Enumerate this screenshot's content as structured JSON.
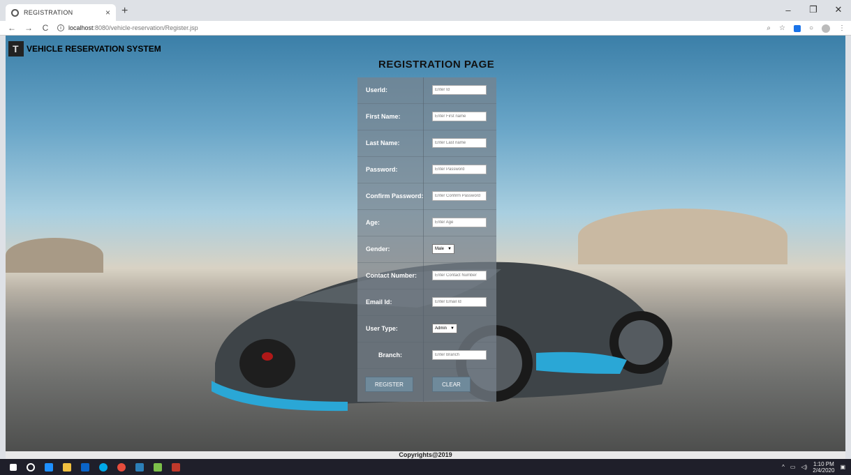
{
  "browser": {
    "tab_title": "REGISTRATION",
    "new_tab": "+",
    "url_host": "localhost",
    "url_path": ":8080/vehicle-reservation/Register.jsp",
    "window_controls": [
      "–",
      "❐",
      "✕"
    ]
  },
  "page": {
    "brand": "VEHICLE RESERVATION SYSTEM",
    "title": "REGISTRATION PAGE",
    "footer": "Copyrights@2019"
  },
  "form": {
    "fields": [
      {
        "label": "UserId:",
        "placeholder": "Enter Id"
      },
      {
        "label": "First Name:",
        "placeholder": "Enter First name"
      },
      {
        "label": "Last Name:",
        "placeholder": "Enter Last name"
      },
      {
        "label": "Password:",
        "placeholder": "Enter Password"
      },
      {
        "label": "Confirm Password:",
        "placeholder": "Enter Confirm Password"
      },
      {
        "label": "Age:",
        "placeholder": "Enter Age"
      },
      {
        "label": "Gender:",
        "value": "Male"
      },
      {
        "label": "Contact Number:",
        "placeholder": "Enter Contact Number"
      },
      {
        "label": "Email Id:",
        "placeholder": "Enter Email Id"
      },
      {
        "label": "User Type:",
        "value": "Admin"
      },
      {
        "label": "Branch:",
        "placeholder": "Enter Branch"
      }
    ],
    "register_label": "REGISTER",
    "clear_label": "CLEAR"
  },
  "taskbar": {
    "time": "1:10 PM",
    "date": "2/4/2020"
  }
}
